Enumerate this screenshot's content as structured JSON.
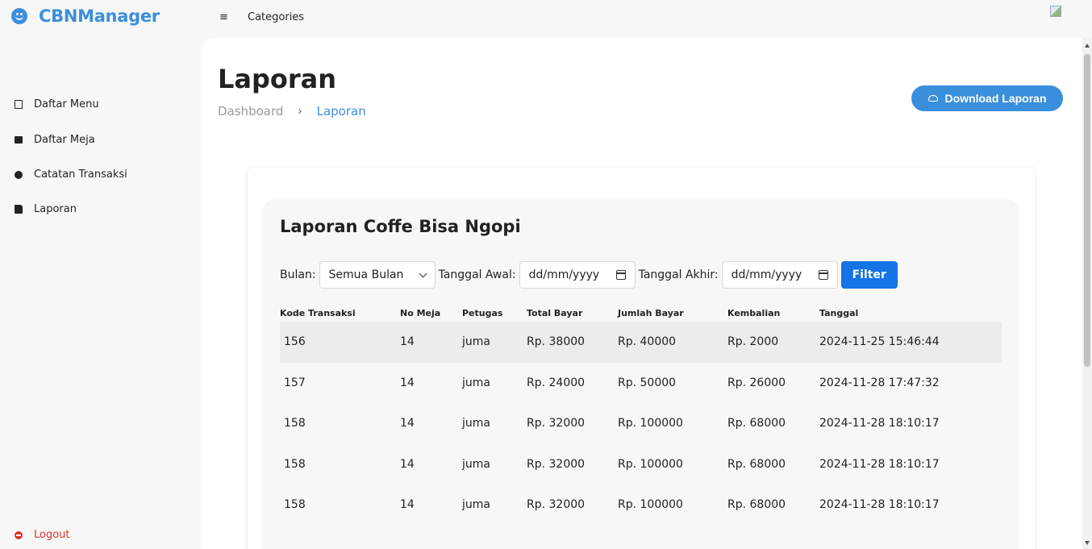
{
  "brand": {
    "title": "CBNManager",
    "icon": "smiley-icon",
    "color": "#3a8fdc"
  },
  "topbar": {
    "menu_icon": "≡",
    "categories_label": "Categories"
  },
  "sidebar": {
    "items": [
      {
        "label": "Daftar Menu",
        "icon": "book-icon"
      },
      {
        "label": "Daftar Meja",
        "icon": "envelope-icon"
      },
      {
        "label": "Catatan Transaksi",
        "icon": "arrow-circle-icon"
      },
      {
        "label": "Laporan",
        "icon": "file-chart-icon"
      }
    ],
    "logout_label": "Logout"
  },
  "page": {
    "title": "Laporan",
    "breadcrumb": {
      "home": "Dashboard",
      "separator": "›",
      "current": "Laporan"
    },
    "download_label": "Download Laporan"
  },
  "report": {
    "title": "Laporan Coffe Bisa Ngopi",
    "filters": {
      "month_label": "Bulan:",
      "month_value": "Semua Bulan",
      "start_label": "Tanggal Awal:",
      "start_placeholder": "dd/mm/yyyy",
      "end_label": "Tanggal Akhir:",
      "end_placeholder": "dd/mm/yyyy",
      "filter_label": "Filter"
    },
    "columns": [
      "Kode Transaksi",
      "No Meja",
      "Petugas",
      "Total Bayar",
      "Jumlah Bayar",
      "Kembalian",
      "Tanggal"
    ],
    "rows": [
      [
        "156",
        "14",
        "juma",
        "Rp. 38000",
        "Rp. 40000",
        "Rp. 2000",
        "2024-11-25 15:46:44"
      ],
      [
        "157",
        "14",
        "juma",
        "Rp. 24000",
        "Rp. 50000",
        "Rp. 26000",
        "2024-11-28 17:47:32"
      ],
      [
        "158",
        "14",
        "juma",
        "Rp. 32000",
        "Rp. 100000",
        "Rp. 68000",
        "2024-11-28 18:10:17"
      ],
      [
        "158",
        "14",
        "juma",
        "Rp. 32000",
        "Rp. 100000",
        "Rp. 68000",
        "2024-11-28 18:10:17"
      ],
      [
        "158",
        "14",
        "juma",
        "Rp. 32000",
        "Rp. 100000",
        "Rp. 68000",
        "2024-11-28 18:10:17"
      ]
    ]
  },
  "colors": {
    "accent": "#3a8fdc",
    "filter_button": "#1473e6",
    "logout": "#d9342b"
  }
}
